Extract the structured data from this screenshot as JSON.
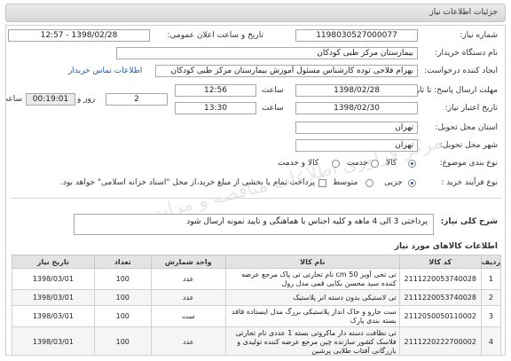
{
  "header": {
    "title": "جزئیات اطلاعات نیاز"
  },
  "watermark": "مرکز فراوری اطلاعات مناقصه و مزایده",
  "form": {
    "need_number": {
      "label": "شماره نیاز:",
      "value": "1198030527000077"
    },
    "announce": {
      "label": "تاریخ و ساعت اعلان عمومی:",
      "value": "1398/02/28 - 12:57"
    },
    "buyer": {
      "label": "نام دستگاه خریدار:",
      "value": "بیمارستان مرکز طبی کودکان"
    },
    "creator": {
      "label": "ایجاد کننده درخواست:",
      "value": "بهرام فلاحی توده کارشناس مسئول آموزش بیمارستان مرکز طبی کودکان",
      "contact_link": "اطلاعات تماس خریدار"
    },
    "send_deadline": {
      "label": "مهلت ارسال پاسخ: تا تاریخ:",
      "date": "1398/02/28",
      "time_label": "ساعت",
      "time": "12:56",
      "days_label": "روز و",
      "days": "2",
      "remaining_time": "00:19:01",
      "remaining_label": "ساعت باقی مانده"
    },
    "validity": {
      "label": "تاریخ اعتبار نیاز:",
      "date": "1398/02/30",
      "time_label": "ساعت",
      "time": "13:30"
    },
    "province": {
      "label": "استان محل تحویل:",
      "value": "تهران"
    },
    "city": {
      "label": "شهر محل تحویل:",
      "value": "تهران"
    },
    "category": {
      "label": "نوع بندی موضوع:",
      "options": [
        "کالا",
        "خدمت",
        "کالا و خدمت"
      ]
    },
    "purchase_type": {
      "label": "نوع فرآیند خرید :",
      "options": [
        "جزیی",
        "متوسط"
      ],
      "note": "پرداخت تمام یا بخشی از مبلغ خرید،از محل \"اسناد خزانه اسلامی\" خواهد بود."
    }
  },
  "description": {
    "label": "شرح کلی نیاز:",
    "text": "پرداختی 3 الی 4 ماهه و کلیه اجناس با هماهنگی و تایید نمونه ارسال شود"
  },
  "goods": {
    "title": "اطلاعات کالاهای مورد نیاز",
    "columns": [
      "ردیف",
      "کد کالا",
      "نام کالا",
      "واحد شمارش",
      "تعداد",
      "تاریخ نیاز"
    ],
    "rows": [
      {
        "index": "1",
        "code": "2111220053740028",
        "name": "تی تخی آویز 50 cm نام تجارتی تی پاک مرجع عرضه کننده سید محسن بکایی قمی مدل رول",
        "unit": "عدد",
        "qty": "100",
        "date": "1398/03/01"
      },
      {
        "index": "2",
        "code": "2111220053740028",
        "name": "تی لاستیکی بدون دسته انر پلاستیک",
        "unit": "عدد",
        "qty": "100",
        "date": "1398/03/01"
      },
      {
        "index": "3",
        "code": "2112050050110002",
        "name": "ست جارو و خاک انداز پلاستیکی بزرگ مدل ایستاده فاقد بسته بندی پارک",
        "unit": "ست",
        "qty": "100",
        "date": "1398/03/01"
      },
      {
        "index": "4",
        "code": "2111220222700002",
        "name": "تی نظافت دسته دار ماکروتی بسته 1 عددی نام تجارتی فلاسک کشور سازنده چین مرجع عرضه کننده تولیدی و بازرگانی آفتاب طلایی پرشین",
        "unit": "عدد",
        "qty": "100",
        "date": "1398/03/01"
      }
    ]
  }
}
